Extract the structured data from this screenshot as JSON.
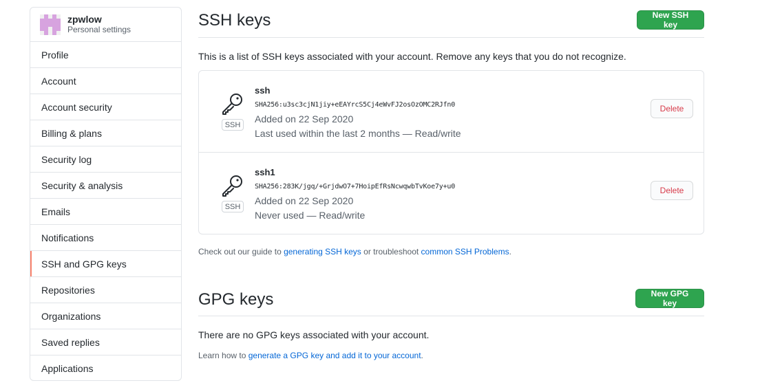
{
  "sidebar": {
    "username": "zpwlow",
    "subtitle": "Personal settings",
    "items": [
      {
        "label": "Profile"
      },
      {
        "label": "Account"
      },
      {
        "label": "Account security"
      },
      {
        "label": "Billing & plans"
      },
      {
        "label": "Security log"
      },
      {
        "label": "Security & analysis"
      },
      {
        "label": "Emails"
      },
      {
        "label": "Notifications"
      },
      {
        "label": "SSH and GPG keys",
        "selected": true
      },
      {
        "label": "Repositories"
      },
      {
        "label": "Organizations"
      },
      {
        "label": "Saved replies"
      },
      {
        "label": "Applications"
      }
    ]
  },
  "ssh": {
    "title": "SSH keys",
    "new_button": "New SSH key",
    "description": "This is a list of SSH keys associated with your account. Remove any keys that you do not recognize.",
    "keys": [
      {
        "name": "ssh",
        "tag": "SSH",
        "fingerprint": "SHA256:u3sc3cjN1jiy+eEAYrcS5Cj4eWvFJ2osOzOMC2RJfn0",
        "added": "Added on 22 Sep 2020",
        "used": "Last used within the last 2 months — Read/write",
        "delete_label": "Delete"
      },
      {
        "name": "ssh1",
        "tag": "SSH",
        "fingerprint": "SHA256:283K/jgq/+GrjdwO7+7HoipEfRsNcwqwbTvKoe7y+u0",
        "added": "Added on 22 Sep 2020",
        "used": "Never used — Read/write",
        "delete_label": "Delete"
      }
    ],
    "guide": {
      "prefix": "Check out our guide to ",
      "link1": "generating SSH keys",
      "middle": " or troubleshoot ",
      "link2": "common SSH Problems",
      "suffix": "."
    }
  },
  "gpg": {
    "title": "GPG keys",
    "new_button": "New GPG key",
    "empty_text": "There are no GPG keys associated with your account.",
    "learn": {
      "prefix": "Learn how to ",
      "link": "generate a GPG key and add it to your account",
      "suffix": "."
    }
  },
  "colors": {
    "primary_button": "#2ea44f",
    "link": "#0366d6",
    "danger": "#d73a49",
    "selected_indicator": "#f9826c",
    "avatar": "#d7a3df"
  },
  "icons": {
    "avatar": "identicon-avatar",
    "key": "key-icon"
  }
}
